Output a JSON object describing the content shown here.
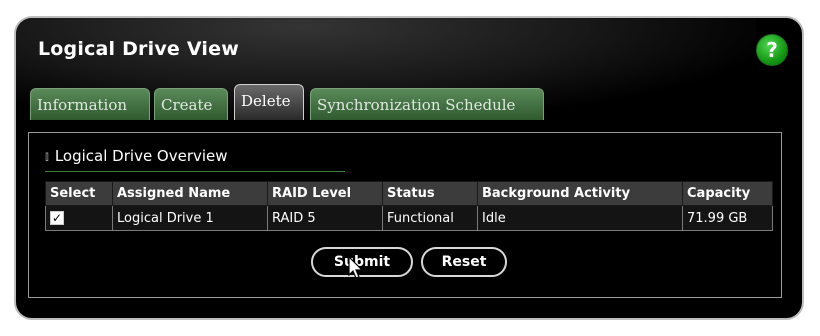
{
  "window": {
    "title": "Logical Drive View",
    "help_label": "?"
  },
  "tabs": [
    {
      "label": "Information"
    },
    {
      "label": "Create"
    },
    {
      "label": "Delete"
    },
    {
      "label": "Synchronization Schedule"
    }
  ],
  "active_tab": "Delete",
  "section": {
    "title": "Logical Drive Overview"
  },
  "table": {
    "headers": [
      "Select",
      "Assigned Name",
      "RAID Level",
      "Status",
      "Background Activity",
      "Capacity"
    ],
    "rows": [
      {
        "select": true,
        "name": "Logical Drive 1",
        "raid": "RAID 5",
        "status": "Functional",
        "activity": "Idle",
        "capacity": "71.99 GB"
      }
    ]
  },
  "buttons": {
    "submit": "Submit",
    "reset": "Reset"
  },
  "colors": {
    "tab_green": "#3e6e3e",
    "help_green": "#1aa31a",
    "frame_border": "#bdbdbd"
  }
}
